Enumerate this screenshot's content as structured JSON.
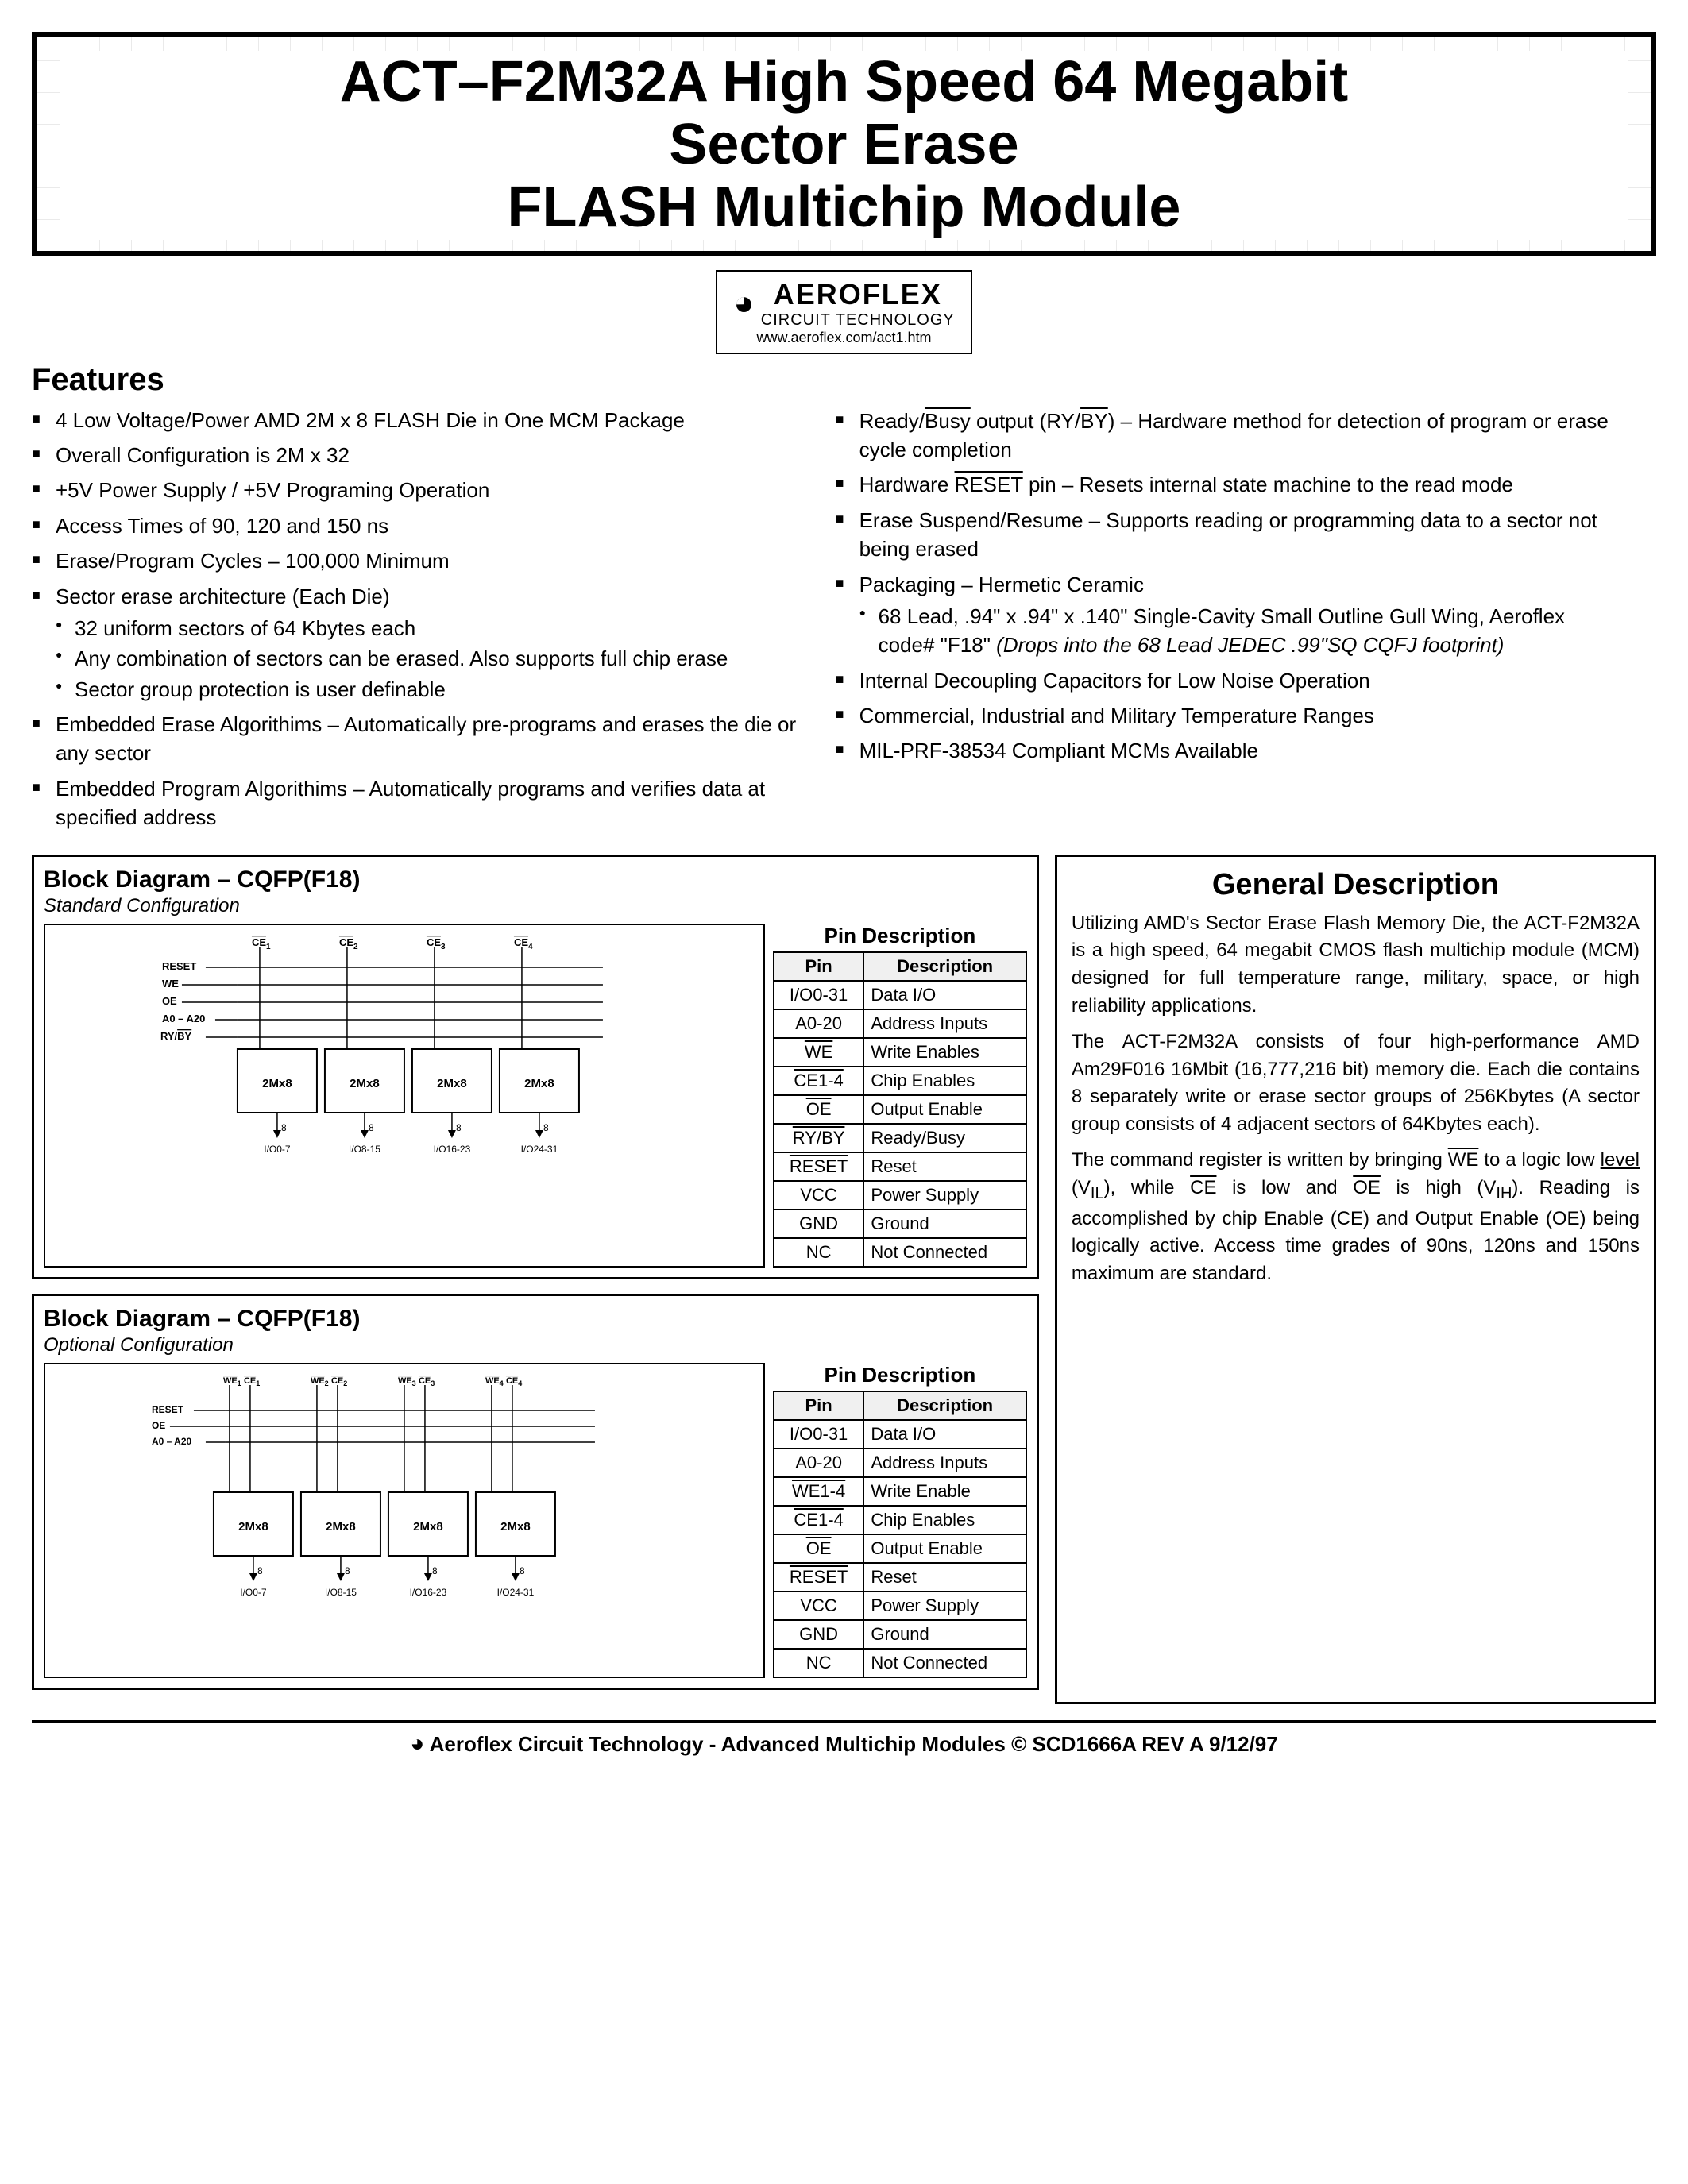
{
  "header": {
    "title_line1": "ACT–F2M32A High Speed 64 Megabit",
    "title_line2": "Sector Erase",
    "title_line3": "FLASH Multichip Module"
  },
  "logo": {
    "name": "AEROFLEX",
    "subtitle": "CIRCUIT TECHNOLOGY",
    "url": "www.aeroflex.com/act1.htm"
  },
  "features": {
    "title": "Features",
    "left_items": [
      "4 Low Voltage/Power AMD 2M x 8 FLASH Die in One MCM Package",
      "Overall Configuration is 2M x 32",
      "+5V Power Supply / +5V Programing Operation",
      "Access Times of 90, 120 and 150 ns",
      "Erase/Program Cycles – 100,000 Minimum",
      "Sector erase architecture (Each Die)",
      "Embedded Erase Algorithims – Automatically pre-programs and erases the die or any sector",
      "Embedded Program Algorithims – Automatically programs and verifies data at specified address"
    ],
    "left_sub": {
      "5": [
        "32 uniform sectors of 64 Kbytes each",
        "Any combination of sectors can be erased. Also supports full chip erase",
        "Sector group protection is user definable"
      ]
    },
    "right_items": [
      "Ready/Busy output (RY/BY) – Hardware method for detection of program or erase cycle completion",
      "Hardware RESET pin – Resets internal state machine to the read mode",
      "Erase Suspend/Resume – Supports reading or programming data to a sector not being erased",
      "Packaging – Hermetic Ceramic",
      "Internal Decoupling Capacitors for Low Noise Operation",
      "Commercial, Industrial and Military Temperature Ranges",
      "MIL-PRF-38534 Compliant MCMs Available"
    ],
    "packaging_sub": [
      "68 Lead, .94\" x .94\" x .140\" Single-Cavity Small Outline Gull Wing, Aeroflex code# \"F18\" (Drops into the 68 Lead JEDEC .99\"SQ CQFJ footprint)"
    ]
  },
  "block_diagram_1": {
    "title": "Block Diagram – CQFP(F18)",
    "config": "Standard Configuration",
    "pin_description_title": "Pin Description",
    "pins": [
      {
        "pin": "I/O0-31",
        "desc": "Data I/O"
      },
      {
        "pin": "A0-20",
        "desc": "Address Inputs"
      },
      {
        "pin": "WE",
        "desc": "Write Enables"
      },
      {
        "pin": "CE1-4",
        "desc": "Chip Enables"
      },
      {
        "pin": "OE",
        "desc": "Output Enable"
      },
      {
        "pin": "RY/BY",
        "desc": "Ready/Busy"
      },
      {
        "pin": "RESET",
        "desc": "Reset"
      },
      {
        "pin": "VCC",
        "desc": "Power Supply"
      },
      {
        "pin": "GND",
        "desc": "Ground"
      },
      {
        "pin": "NC",
        "desc": "Not Connected"
      }
    ],
    "left_signals": [
      "RESET",
      "WE",
      "OE",
      "A0 – A20",
      "RY/BY"
    ],
    "top_labels": [
      "CE1",
      "CE2",
      "CE3",
      "CE4"
    ],
    "box_labels": [
      "2Mx8",
      "2Mx8",
      "2Mx8",
      "2Mx8"
    ],
    "bottom_labels": [
      "I/O0-7",
      "I/O8-15",
      "I/O16-23",
      "I/O24-31"
    ],
    "arrow_val": "8"
  },
  "block_diagram_2": {
    "title": "Block Diagram – CQFP(F18)",
    "config": "Optional Configuration",
    "pin_description_title": "Pin Description",
    "pins": [
      {
        "pin": "I/O0-31",
        "desc": "Data I/O"
      },
      {
        "pin": "A0-20",
        "desc": "Address Inputs"
      },
      {
        "pin": "WE1-4",
        "desc": "Write Enable"
      },
      {
        "pin": "CE1-4",
        "desc": "Chip Enables"
      },
      {
        "pin": "OE",
        "desc": "Output Enable"
      },
      {
        "pin": "RESET",
        "desc": "Reset"
      },
      {
        "pin": "VCC",
        "desc": "Power Supply"
      },
      {
        "pin": "GND",
        "desc": "Ground"
      },
      {
        "pin": "NC",
        "desc": "Not Connected"
      }
    ],
    "left_signals": [
      "RESET",
      "OE",
      "A0 – A20"
    ],
    "top_labels": [
      "WE1",
      "CE1",
      "WE2",
      "CE2",
      "WE3",
      "CE3",
      "WE4",
      "CE4"
    ],
    "box_labels": [
      "2Mx8",
      "2Mx8",
      "2Mx8",
      "2Mx8"
    ],
    "bottom_labels": [
      "I/O0-7",
      "I/O8-15",
      "I/O16-23",
      "I/O24-31"
    ],
    "arrow_val": "8"
  },
  "general_description": {
    "title": "General Description",
    "paragraphs": [
      "Utilizing AMD's Sector Erase Flash Memory Die, the ACT-F2M32A is a high speed, 64 megabit CMOS flash multichip module (MCM) designed for full temperature range, military, space, or high reliability applications.",
      "The ACT-F2M32A consists of four high-performance AMD Am29F016 16Mbit (16,777,216 bit) memory die. Each die contains 8 separately write or erase sector groups of 256Kbytes (A sector group consists of 4 adjacent sectors of 64Kbytes each).",
      "The command register is written by bringing WE to a logic low level (VIL), while CE is low and OE is high (VIH). Reading is accomplished by chip Enable (CE) and Output Enable (OE) being logically active. Access time grades of 90ns, 120ns and 150ns maximum are standard."
    ]
  },
  "footer": {
    "logo_text": "Aeroflex Circuit Technology",
    "text": "- Advanced Multichip Modules © SCD1666A REV A  9/12/97"
  }
}
